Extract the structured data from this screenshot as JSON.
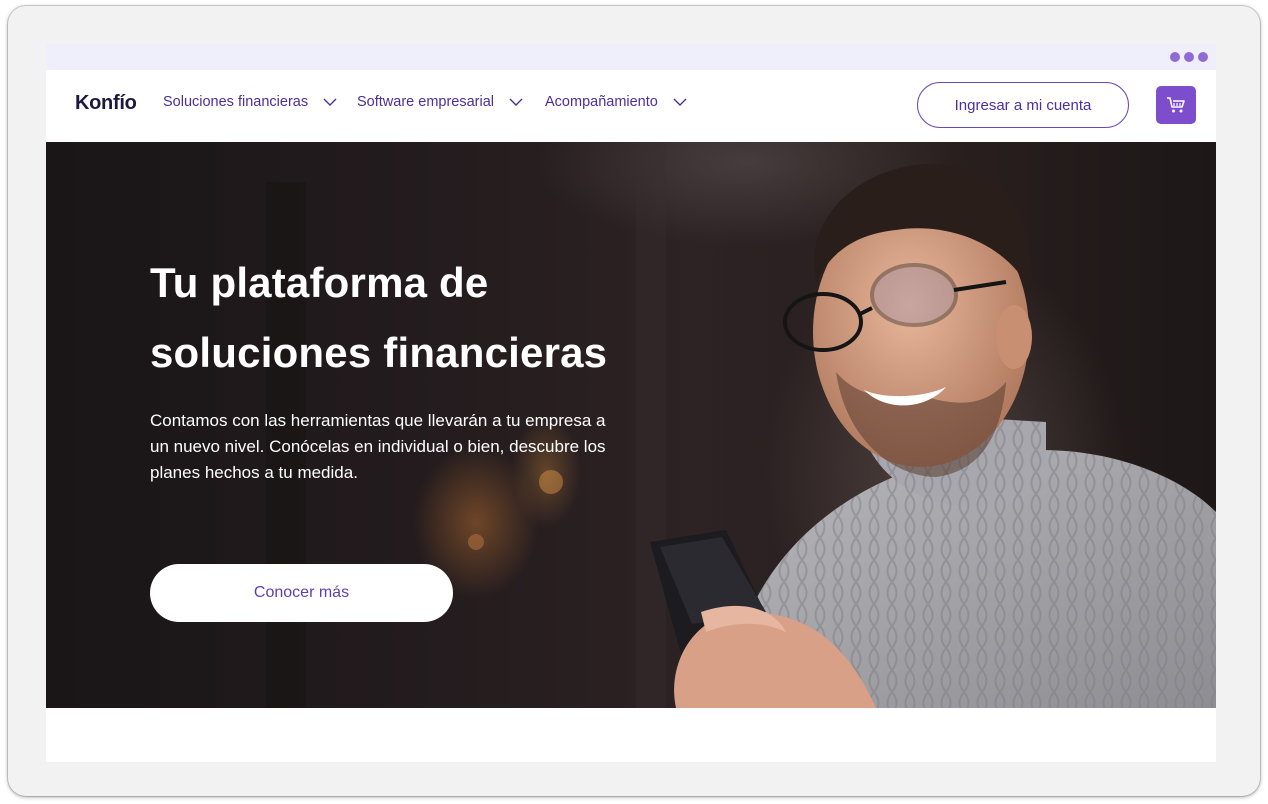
{
  "colors": {
    "brand_purple": "#7c4dcc",
    "nav_text": "#4b2f9b",
    "chrome_bar": "#efeefb",
    "hero_text": "#ffffff"
  },
  "chrome": {
    "menu_icon": "three-dots-icon"
  },
  "header": {
    "logo": "Konfío",
    "nav": [
      {
        "label": "Soluciones financieras",
        "icon": "chevron-down-icon"
      },
      {
        "label": "Software empresarial",
        "icon": "chevron-down-icon"
      },
      {
        "label": "Acompañamiento",
        "icon": "chevron-down-icon"
      }
    ],
    "login_label": "Ingresar a mi cuenta",
    "cart_icon": "shopping-cart-icon"
  },
  "hero": {
    "title_line1": "Tu plataforma de",
    "title_line2": "soluciones financieras",
    "subtitle": "Contamos con las herramientas que llevarán a tu empresa a un nuevo nivel. Conócelas en individual o bien, descubre los planes hechos a tu medida.",
    "cta_label": "Conocer más",
    "image": "smiling-man-with-glasses-holding-phone"
  }
}
